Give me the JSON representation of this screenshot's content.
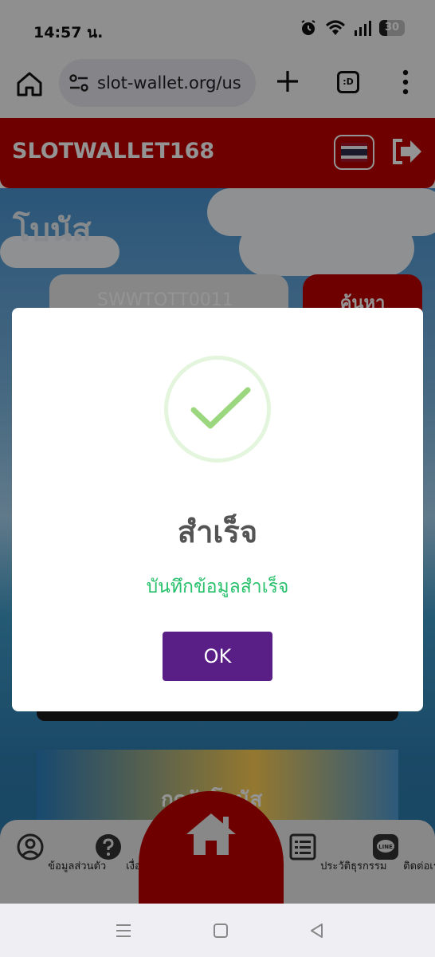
{
  "status_bar": {
    "time": "14:57 น.",
    "battery": "30",
    "battery_level": 0.3,
    "icons": [
      "alarm-icon",
      "wifi-icon",
      "signal-icon",
      "battery-icon"
    ]
  },
  "browser": {
    "url": "slot-wallet.org/us",
    "tabs_label": ":D"
  },
  "header": {
    "brand": "SLOTWALLET168"
  },
  "page": {
    "title": "โบนัส",
    "search_placeholder": "SWWTOTT0011",
    "search_button": "ค้นหา",
    "banner_text": "กดรับโบนัส"
  },
  "dialog": {
    "title": "สำเร็จ",
    "message": "บันทึกข้อมูลสำเร็จ",
    "ok_label": "OK"
  },
  "bottom_nav": {
    "items": [
      {
        "label": "ข้อมูลส่วนตัว",
        "icon": "user-circle-icon"
      },
      {
        "label": "เงื่อนไข",
        "icon": "question-circle-icon"
      },
      {
        "label": "ประวัติธุรกรรม",
        "icon": "list-icon"
      },
      {
        "label": "ติดต่อเรา",
        "icon": "line-chat-icon"
      }
    ],
    "home_icon": "home-icon"
  },
  "colors": {
    "brand_red": "#c00000",
    "ok_purple": "#5a1f86",
    "success_green": "#27c06b"
  }
}
